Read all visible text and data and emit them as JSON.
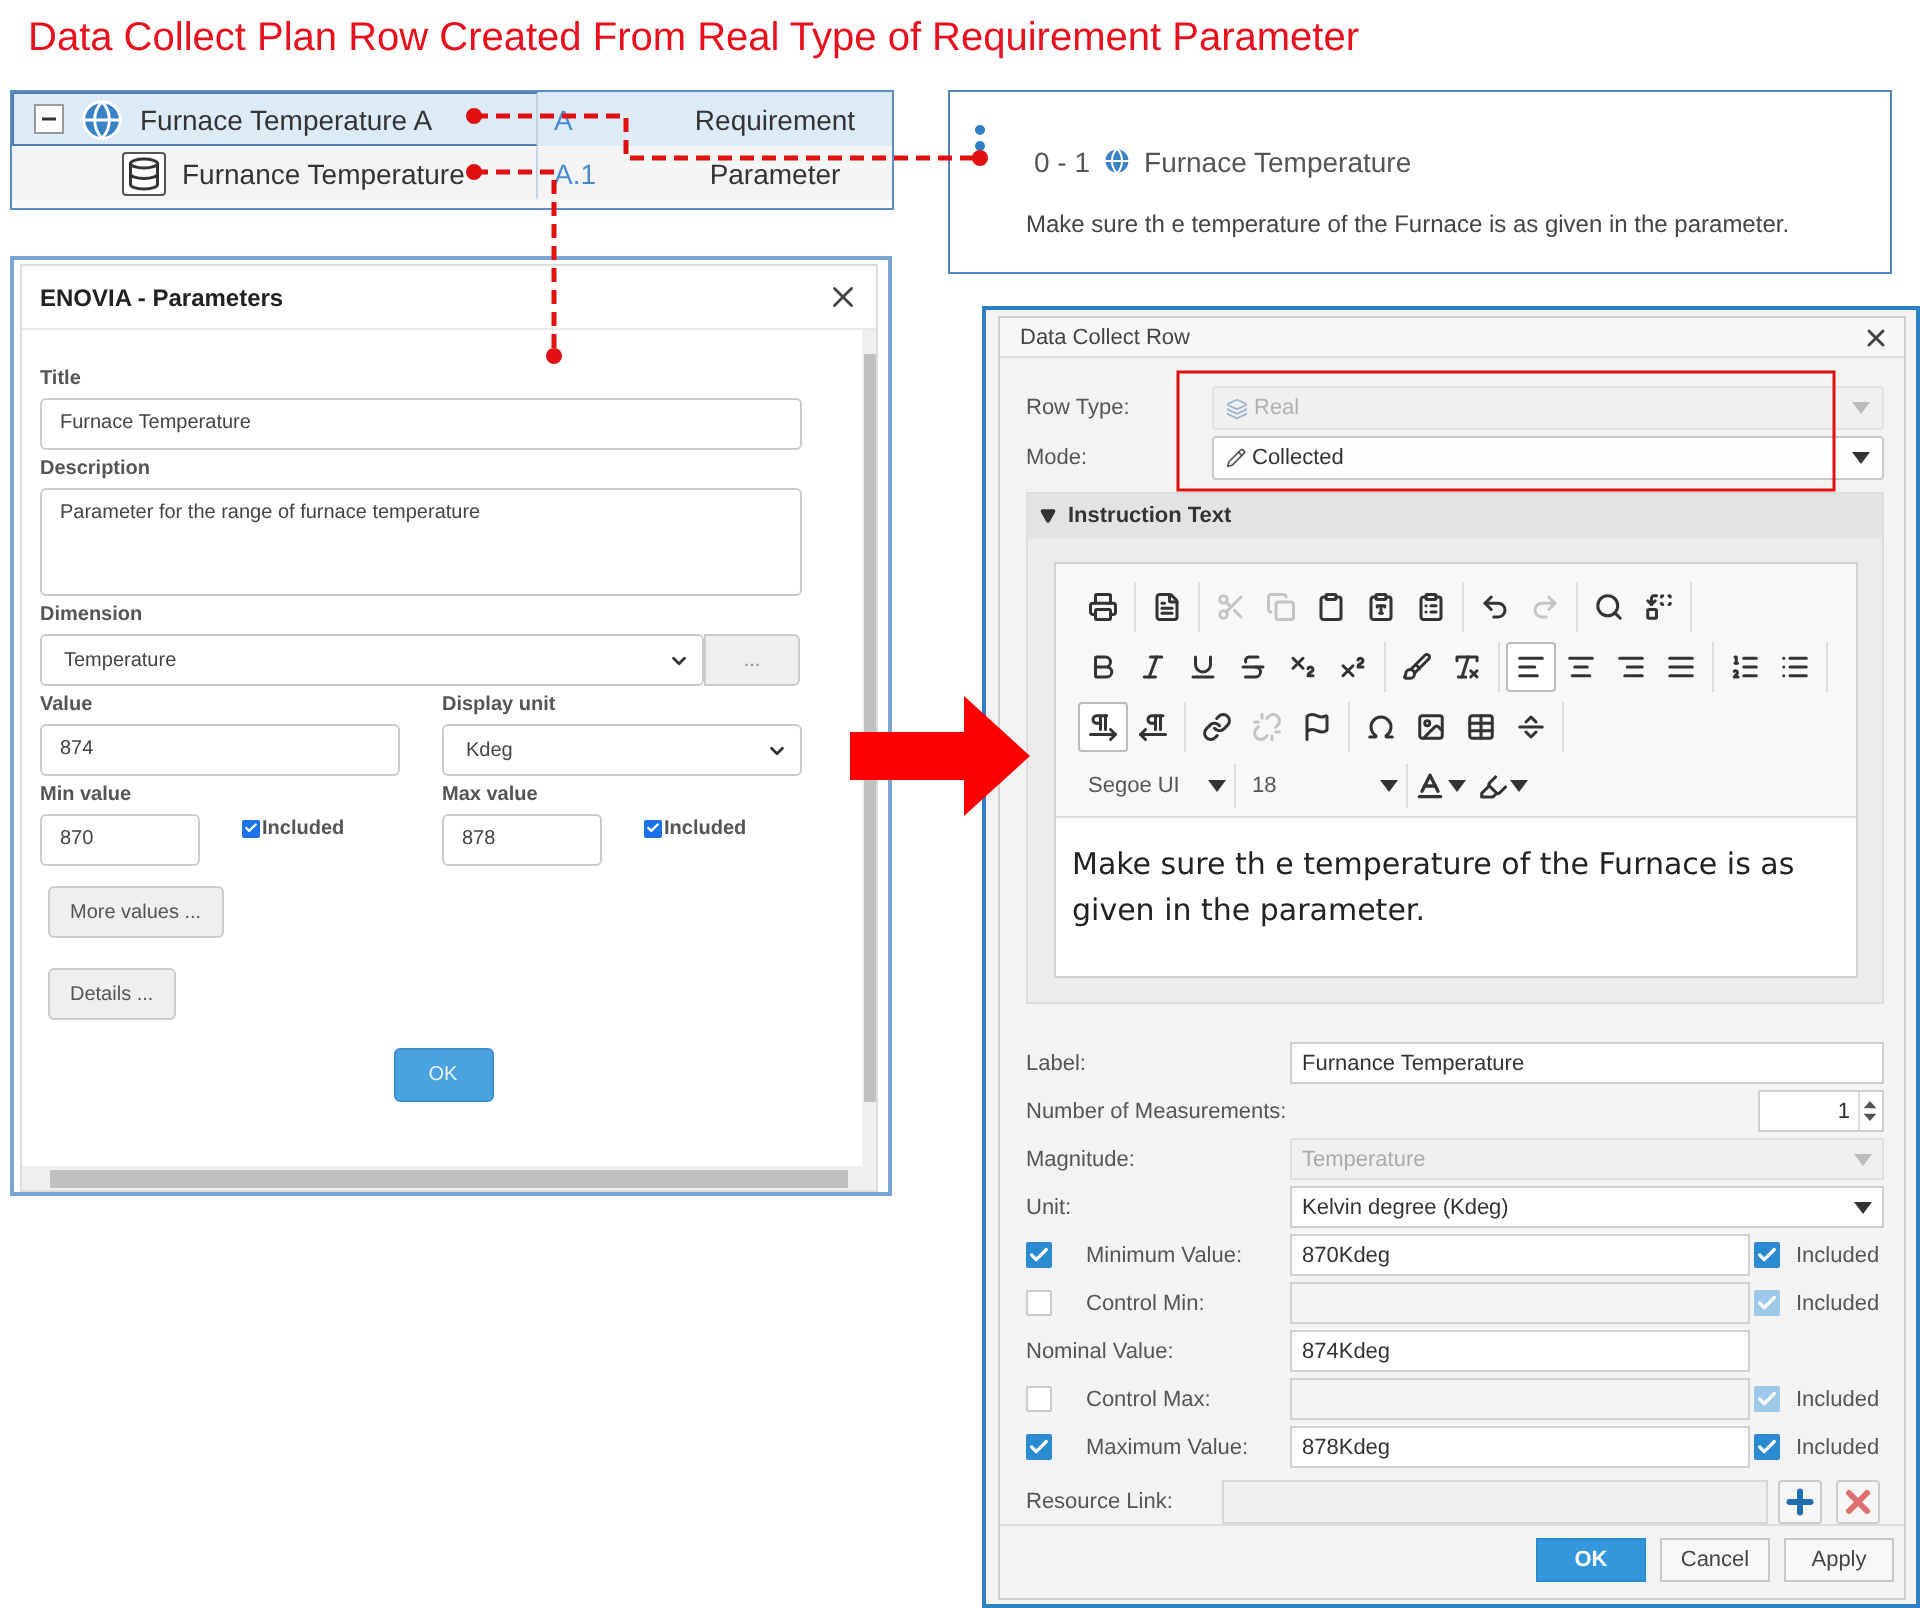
{
  "heading": "Data Collect Plan Row Created From Real Type of Requirement Parameter",
  "tree": {
    "items": [
      {
        "name": "Furnace Temperature A",
        "id": "A",
        "type": "Requirement",
        "selected": true,
        "expanded": true,
        "children": [
          {
            "name": "Furnance Temperature",
            "id": "A.1",
            "type": "Parameter",
            "selected": false
          }
        ]
      }
    ]
  },
  "card": {
    "range": "0 - 1",
    "title": "Furnace Temperature",
    "text": "Make sure th e temperature of the Furnace is as given in the parameter."
  },
  "parameters_dialog": {
    "title": "ENOVIA - Parameters",
    "title_field": {
      "label": "Title",
      "value": "Furnace Temperature"
    },
    "description": {
      "label": "Description",
      "value": "Parameter for the range of furnace temperature"
    },
    "dimension": {
      "label": "Dimension",
      "value": "Temperature",
      "more": "..."
    },
    "value": {
      "label": "Value",
      "value": "874"
    },
    "display_unit": {
      "label": "Display unit",
      "value": "Kdeg"
    },
    "min": {
      "label": "Min value",
      "value": "870",
      "included_label": "Included",
      "included": true
    },
    "max": {
      "label": "Max value",
      "value": "878",
      "included_label": "Included",
      "included": true
    },
    "buttons": [
      "More values ...",
      "Details ..."
    ],
    "ok": "OK"
  },
  "data_collect_row": {
    "title": "Data Collect Row",
    "row_type": {
      "label": "Row Type:",
      "value": "Real",
      "disabled": true
    },
    "mode": {
      "label": "Mode:",
      "value": "Collected",
      "disabled": false
    },
    "instruction": {
      "title": "Instruction Text",
      "expanded": true,
      "toolbar": [
        [
          [
            {
              "kind": "print",
              "selected": false,
              "disabled": false
            }
          ],
          [
            {
              "kind": "templates",
              "selected": false,
              "disabled": false
            }
          ],
          [
            {
              "kind": "cut",
              "selected": false,
              "disabled": true
            },
            {
              "kind": "copy",
              "selected": false,
              "disabled": true
            },
            {
              "kind": "paste",
              "selected": false,
              "disabled": false
            },
            {
              "kind": "pastetext",
              "selected": false,
              "disabled": false
            },
            {
              "kind": "pasteword",
              "selected": false,
              "disabled": false
            }
          ],
          [
            {
              "kind": "undo",
              "selected": false,
              "disabled": false
            },
            {
              "kind": "redo",
              "selected": false,
              "disabled": true
            }
          ],
          [
            {
              "kind": "find",
              "selected": false,
              "disabled": false
            },
            {
              "kind": "replace",
              "selected": false,
              "disabled": false
            }
          ]
        ],
        [
          [
            {
              "kind": "bold",
              "selected": false,
              "disabled": false
            },
            {
              "kind": "italic",
              "selected": false,
              "disabled": false
            },
            {
              "kind": "underline",
              "selected": false,
              "disabled": false
            },
            {
              "kind": "strike",
              "selected": false,
              "disabled": false
            },
            {
              "kind": "subscript",
              "selected": false,
              "disabled": false
            },
            {
              "kind": "superscript",
              "selected": false,
              "disabled": false
            }
          ],
          [
            {
              "kind": "brush",
              "selected": false,
              "disabled": false
            },
            {
              "kind": "clear",
              "selected": false,
              "disabled": false
            }
          ],
          [
            {
              "kind": "left",
              "selected": true,
              "disabled": false
            },
            {
              "kind": "center",
              "selected": false,
              "disabled": false
            },
            {
              "kind": "right",
              "selected": false,
              "disabled": false
            },
            {
              "kind": "justify",
              "selected": false,
              "disabled": false
            }
          ],
          [
            {
              "kind": "numbered",
              "selected": false,
              "disabled": false
            },
            {
              "kind": "bulleted",
              "selected": false,
              "disabled": false
            }
          ]
        ],
        [
          [
            {
              "kind": "ltr",
              "selected": true,
              "disabled": false
            },
            {
              "kind": "rtl",
              "selected": false,
              "disabled": false
            }
          ],
          [
            {
              "kind": "link",
              "selected": false,
              "disabled": false
            },
            {
              "kind": "unlink",
              "selected": false,
              "disabled": true
            },
            {
              "kind": "anchor",
              "selected": false,
              "disabled": false
            }
          ],
          [
            {
              "kind": "symbol",
              "selected": false,
              "disabled": false
            },
            {
              "kind": "image",
              "selected": false,
              "disabled": false
            },
            {
              "kind": "table",
              "selected": false,
              "disabled": false
            },
            {
              "kind": "rule",
              "selected": false,
              "disabled": false
            }
          ]
        ]
      ],
      "font": "Segoe UI",
      "size": "18",
      "text": "Make sure th e temperature of the Furnace is as given in the parameter."
    },
    "label": {
      "label": "Label:",
      "value": "Furnance Temperature"
    },
    "measurements": {
      "label": "Number of Measurements:",
      "value": "1"
    },
    "magnitude": {
      "label": "Magnitude:",
      "value": "Temperature",
      "disabled": true
    },
    "unit": {
      "label": "Unit:",
      "value": "Kelvin degree (Kdeg)",
      "disabled": false
    },
    "limits": [
      {
        "kind": "limit",
        "label": "Minimum Value:",
        "checked": true,
        "value": "870Kdeg",
        "included_label": "Included",
        "included": true
      },
      {
        "kind": "limit",
        "label": "Control Min:",
        "checked": false,
        "included_label": "Included",
        "included": true
      },
      {
        "kind": "nominal",
        "label": "Nominal Value:",
        "value": "874Kdeg"
      },
      {
        "kind": "limit",
        "label": "Control Max:",
        "checked": false,
        "included_label": "Included",
        "included": true
      },
      {
        "kind": "limit",
        "label": "Maximum Value:",
        "checked": true,
        "value": "878Kdeg",
        "included_label": "Included",
        "included": true
      }
    ],
    "resource_link": {
      "label": "Resource Link:"
    },
    "buttons": [
      {
        "label": "OK",
        "primary": true
      },
      {
        "label": "Cancel",
        "primary": false
      },
      {
        "label": "Apply",
        "primary": false
      }
    ]
  }
}
